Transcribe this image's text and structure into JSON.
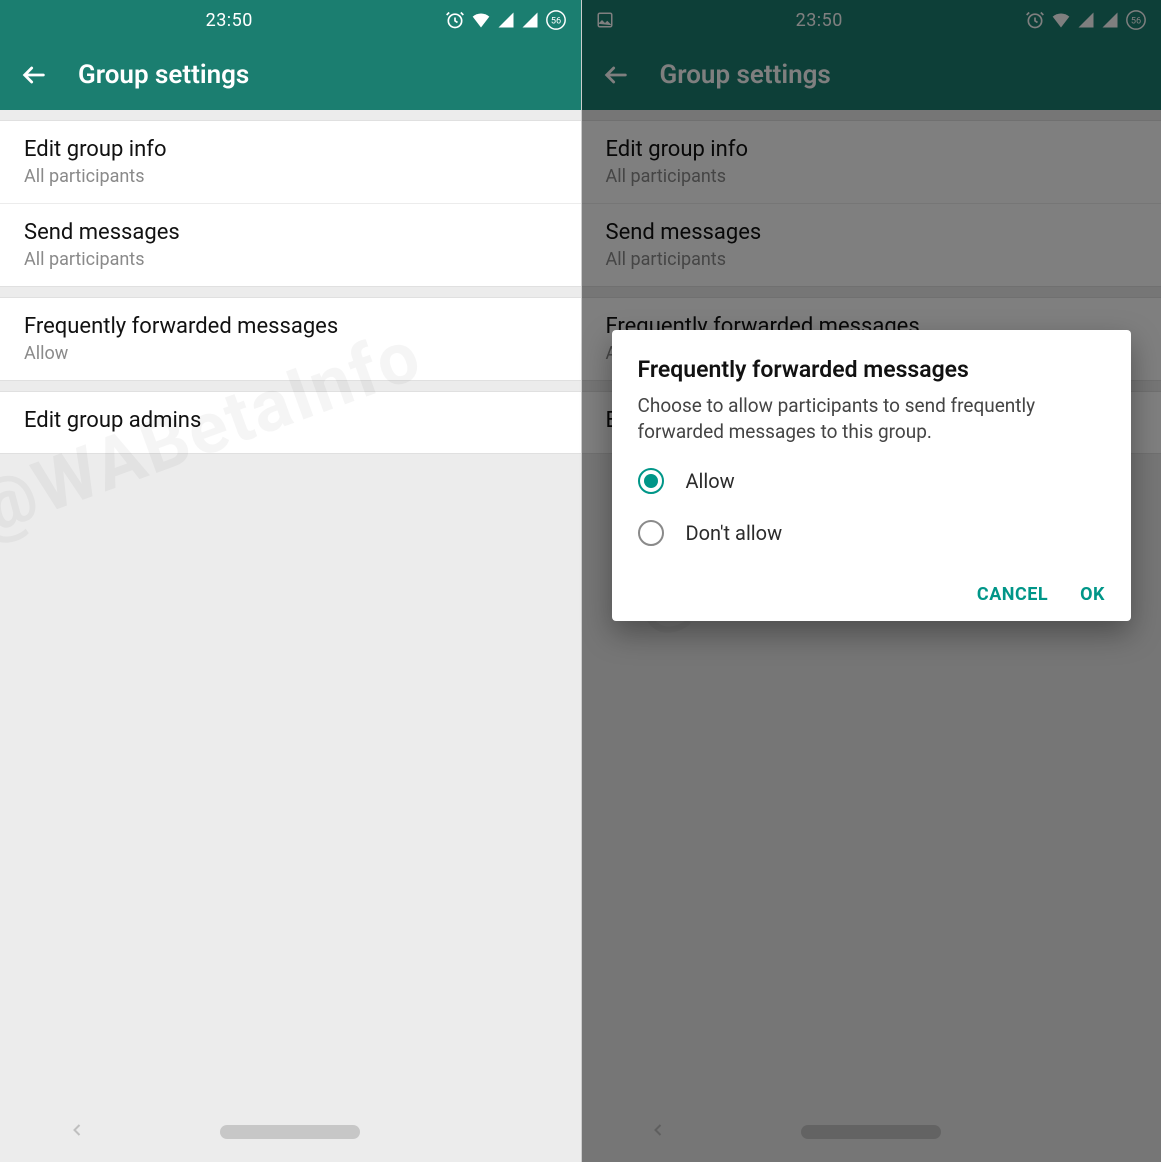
{
  "status": {
    "time": "23:50",
    "battery": "56"
  },
  "header": {
    "title": "Group settings"
  },
  "settings": {
    "groupA": [
      {
        "title": "Edit group info",
        "sub": "All participants"
      },
      {
        "title": "Send messages",
        "sub": "All participants"
      }
    ],
    "groupB": [
      {
        "title": "Frequently forwarded messages",
        "sub": "Allow"
      }
    ],
    "groupC": [
      {
        "title": "Edit group admins"
      }
    ]
  },
  "dialog": {
    "title": "Frequently forwarded messages",
    "desc": "Choose to allow participants to send frequently forwarded messages to this group.",
    "options": [
      {
        "label": "Allow",
        "selected": true
      },
      {
        "label": "Don't allow",
        "selected": false
      }
    ],
    "cancel": "CANCEL",
    "ok": "OK"
  },
  "watermark": "@WABetaInfo"
}
